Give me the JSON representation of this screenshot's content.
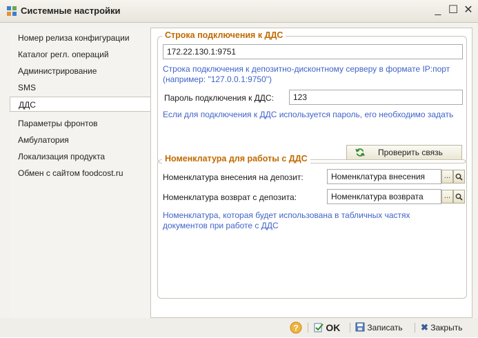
{
  "window": {
    "title": "Системные настройки",
    "controls": {
      "minimize": "_",
      "maximize": "☐",
      "close": "✕"
    }
  },
  "sidebar": {
    "items": [
      {
        "label": "Номер релиза конфигурации"
      },
      {
        "label": "Каталог регл. операций"
      },
      {
        "label": "Администрирование"
      },
      {
        "label": "SMS"
      },
      {
        "label": "ДДС"
      },
      {
        "label": "Параметры фронтов"
      },
      {
        "label": "Амбулатория"
      },
      {
        "label": "Локализация продукта"
      },
      {
        "label": "Обмен с сайтом foodcost.ru"
      }
    ],
    "selected_index": 4
  },
  "dds_connection": {
    "legend": "Строка подключения к ДДС",
    "connection_string": "172.22.130.1:9751",
    "connection_hint": "Строка подключения к депозитно-дисконтному серверу в формате IP:порт (например: \"127.0.0.1:9750\")",
    "password_label": "Пароль подключения к ДДС:",
    "password_value": "123",
    "password_hint": "Если для подключения к ДДС используется пароль, его необходимо задать",
    "check_button": "Проверить связь"
  },
  "nomenclature": {
    "legend": "Номенклатура для работы с ДДС",
    "deposit_in_label": "Номенклатура внесения на депозит:",
    "deposit_in_value": "Номенклатура внесения",
    "deposit_out_label": "Номенклатура возврат с депозита:",
    "deposit_out_value": "Номенклатура возврата",
    "select_button": "...",
    "hint": "Номенклатура, которая будет использована в табличных частях документов при работе с ДДС"
  },
  "footer": {
    "ok_label": "OK",
    "save_label": "Записать",
    "close_label": "Закрыть"
  },
  "colors": {
    "legend": "#c26a00",
    "hint": "#3f63c9"
  }
}
